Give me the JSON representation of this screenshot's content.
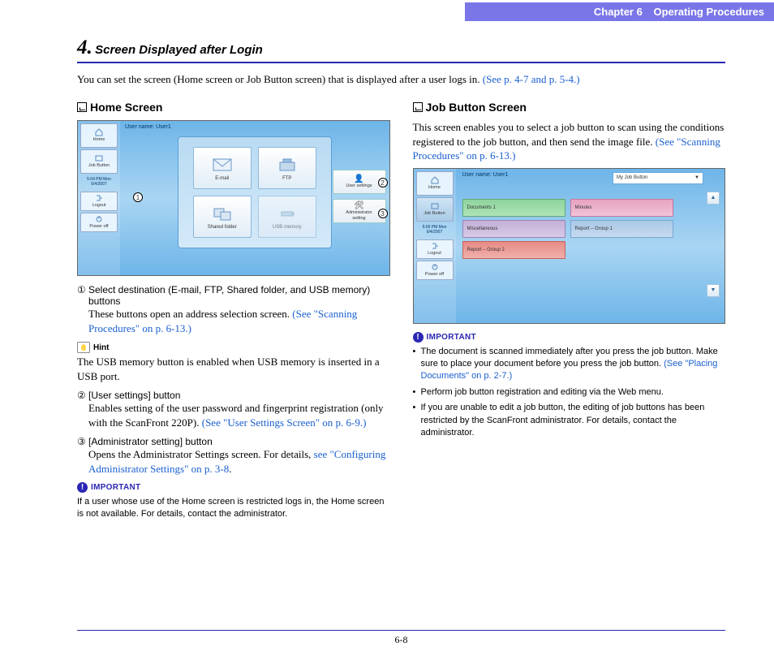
{
  "chapter": {
    "label": "Chapter 6",
    "title": "Operating Procedures"
  },
  "section": {
    "number": "4.",
    "title": "Screen Displayed after Login"
  },
  "intro": {
    "text": "You can set the screen (Home screen or Job Button screen) that is displayed after a user logs in. ",
    "link": "(See p. 4-7 and p. 5-4.)"
  },
  "left": {
    "heading": "Home Screen",
    "screenshot": {
      "user": "User name: User1",
      "time1": "5:04 PM  Mon",
      "time2": "6/4/2007",
      "sidebar": {
        "home": "Home",
        "job": "Job Button",
        "logout": "Logout",
        "power": "Power off"
      },
      "buttons": {
        "email": "E-mail",
        "ftp": "FTP",
        "shared": "Shared folder",
        "usb": "USB memory"
      },
      "right": {
        "user_settings": "User settings",
        "admin_line1": "Administrator",
        "admin_line2": "setting"
      }
    },
    "items": [
      {
        "num": "①",
        "head": "Select destination (E-mail, FTP, Shared folder, and USB memory) buttons",
        "body": "These buttons open an address selection screen. ",
        "body_link": "(See \"Scanning Procedures\" on p. 6-13.)"
      },
      {
        "num": "②",
        "head": "[User settings] button",
        "body": "Enables setting of the user password and fingerprint registration (only with the ScanFront 220P). ",
        "body_link": "(See \"User Settings Screen\" on p. 6-9.)"
      },
      {
        "num": "③",
        "head": "[Administrator setting] button",
        "body": "Opens the Administrator Settings screen. For details, ",
        "body_link": "see \"Configuring Administrator Settings\" on p. 3-8",
        "tail": "."
      }
    ],
    "hint": {
      "label": "Hint",
      "text": "The USB memory button is enabled when USB memory is inserted in a USB port."
    },
    "important": {
      "label": "IMPORTANT",
      "text": "If a user whose use of the Home screen is restricted logs in, the Home screen is not available. For details, contact the administrator."
    }
  },
  "right": {
    "heading": "Job Button Screen",
    "para": {
      "text": "This screen enables you to select a job button to scan using the conditions registered to the job button, and then send the image file. ",
      "link": "(See \"Scanning Procedures\" on p. 6-13.)"
    },
    "screenshot": {
      "user": "User name: User1",
      "time1": "5:06 PM  Mon",
      "time2": "6/4/2007",
      "dropdown": "My Job Button",
      "sidebar": {
        "home": "Home",
        "job": "Job Button",
        "logout": "Logout",
        "power": "Power off"
      },
      "jobs": {
        "a": "Documents 1",
        "b": "Minutes",
        "c": "Miscellaneous",
        "d": "Report – Group 1",
        "e": "Report – Group 2"
      }
    },
    "important": {
      "label": "IMPORTANT"
    },
    "bullets": [
      {
        "text": "The document is scanned immediately after you press the job button. Make sure to place your document before you press the job button. ",
        "link": "(See \"Placing Documents\" on p. 2-7.)"
      },
      {
        "text": "Perform job button registration and editing via the Web menu."
      },
      {
        "text": "If you are unable to edit a job button, the editing of job buttons has been restricted by the ScanFront administrator. For details, contact the administrator."
      }
    ]
  },
  "footer": "6-8"
}
